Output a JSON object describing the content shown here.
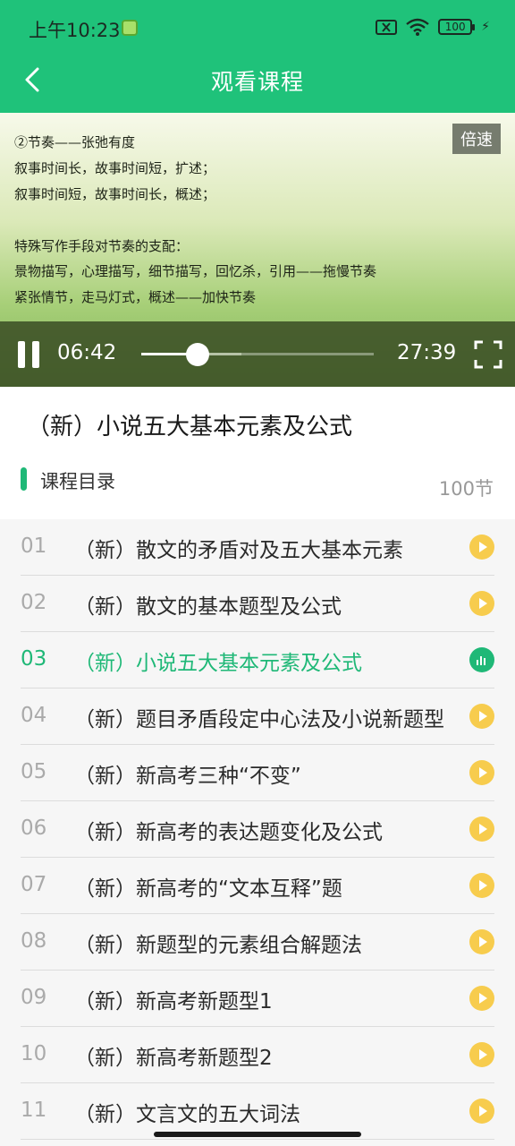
{
  "status_bar": {
    "time": "上午10:23",
    "battery": "100"
  },
  "header": {
    "title": "观看课程"
  },
  "video": {
    "slide_lines": [
      "②节奏——张弛有度",
      "叙事时间长，故事时间短，扩述；",
      "叙事时间短，故事时间长，概述；",
      "",
      "特殊写作手段对节奏的支配：",
      "景物描写，心理描写，细节描写，回忆杀，引用——拖慢节奏",
      "紧张情节，走马灯式，概述——加快节奏"
    ],
    "speed_label": "倍速",
    "current_time": "06:42",
    "duration": "27:39",
    "progress_fraction": 0.242,
    "buffered_fraction": 0.43
  },
  "course": {
    "title": "（新）小说五大基本元素及公式"
  },
  "catalog": {
    "label": "课程目录",
    "count": "100节",
    "lessons": [
      {
        "num": "01",
        "title": "（新）散文的矛盾对及五大基本元素",
        "active": false
      },
      {
        "num": "02",
        "title": "（新）散文的基本题型及公式",
        "active": false
      },
      {
        "num": "03",
        "title": "（新）小说五大基本元素及公式",
        "active": true
      },
      {
        "num": "04",
        "title": "（新）题目矛盾段定中心法及小说新题型",
        "active": false
      },
      {
        "num": "05",
        "title": "（新）新高考三种“不变”",
        "active": false
      },
      {
        "num": "06",
        "title": "（新）新高考的表达题变化及公式",
        "active": false
      },
      {
        "num": "07",
        "title": "（新）新高考的“文本互释”题",
        "active": false
      },
      {
        "num": "08",
        "title": "（新）新题型的元素组合解题法",
        "active": false
      },
      {
        "num": "09",
        "title": "（新）新高考新题型1",
        "active": false
      },
      {
        "num": "10",
        "title": "（新）新高考新题型2",
        "active": false
      },
      {
        "num": "11",
        "title": "（新）文言文的五大词法",
        "active": false
      }
    ]
  }
}
